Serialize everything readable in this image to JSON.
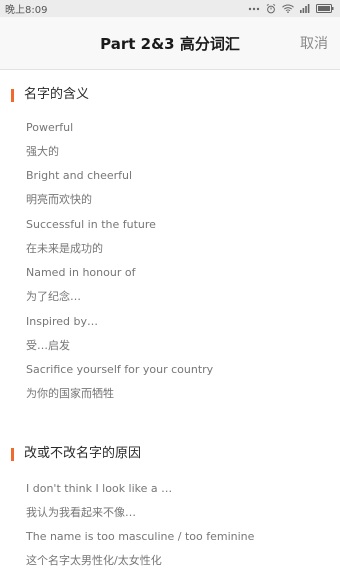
{
  "status_bar": {
    "time": "晚上8:09"
  },
  "header": {
    "title": "Part 2&3 高分词汇",
    "cancel_label": "取消"
  },
  "sections": [
    {
      "title": "名字的含义",
      "items": [
        "Powerful",
        "强大的",
        "Bright and cheerful",
        "明亮而欢快的",
        "Successful in the future",
        "在未来是成功的",
        "Named in honour of",
        "为了纪念…",
        "Inspired by…",
        "受…启发",
        "Sacrifice yourself for your country",
        "为你的国家而牺牲"
      ]
    },
    {
      "title": "改或不改名字的原因",
      "items": [
        "I don't think I look like a …",
        "我认为我看起来不像…",
        "The name is too masculine / too feminine",
        "这个名字太男性化/太女性化"
      ]
    }
  ]
}
